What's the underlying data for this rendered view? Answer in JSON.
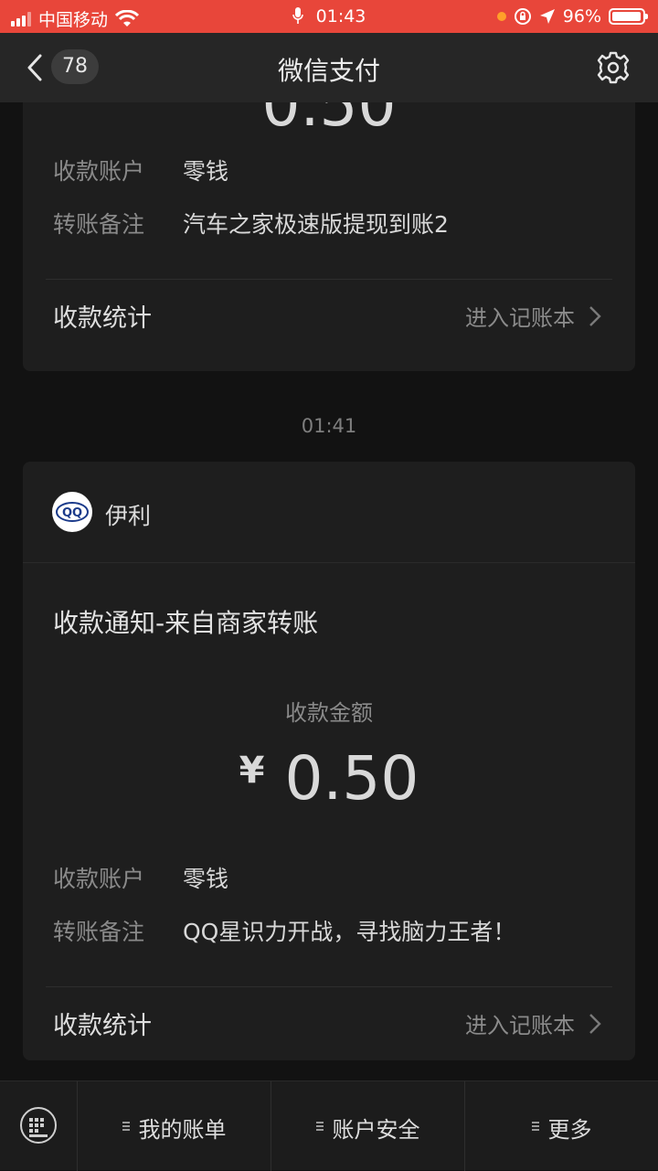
{
  "status_bar": {
    "carrier": "中国移动",
    "time": "01:43",
    "battery_percent": "96%",
    "battery_level": 0.96
  },
  "nav": {
    "back_count": "78",
    "title": "微信支付"
  },
  "previous_card": {
    "partial_amount": "0.50",
    "fields": [
      {
        "label": "收款账户",
        "value": "零钱"
      },
      {
        "label": "转账备注",
        "value": "汽车之家极速版提现到账2"
      }
    ],
    "stats_label": "收款统计",
    "stats_link": "进入记账本"
  },
  "message_time": "01:41",
  "current_card": {
    "merchant_name": "伊利",
    "merchant_logo_text": "QQ",
    "title": "收款通知-来自商家转账",
    "amount_label": "收款金额",
    "currency": "¥",
    "amount": "0.50",
    "fields": [
      {
        "label": "收款账户",
        "value": "零钱"
      },
      {
        "label": "转账备注",
        "value": "QQ星识力开战，寻找脑力王者！"
      }
    ],
    "stats_label": "收款统计",
    "stats_link": "进入记账本"
  },
  "bottom_tabs": [
    {
      "label": "我的账单"
    },
    {
      "label": "账户安全"
    },
    {
      "label": "更多"
    }
  ]
}
